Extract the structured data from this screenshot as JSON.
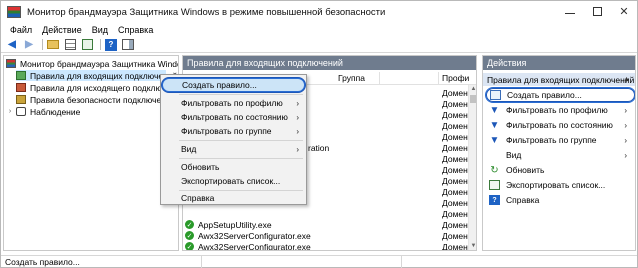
{
  "window": {
    "title": "Монитор брандмауэра Защитника Windows в режиме повышенной безопасности"
  },
  "menubar": [
    "Файл",
    "Действие",
    "Вид",
    "Справка"
  ],
  "tree": {
    "items": [
      {
        "label": "Монитор брандмауэра Защитника Windows в",
        "icon": "firewall-icon"
      },
      {
        "label": "Правила для входящих подключений",
        "icon": "inbound-rules-icon",
        "selected": true
      },
      {
        "label": "Правила для исходящего подключения",
        "icon": "outbound-rules-icon"
      },
      {
        "label": "Правила безопасности подключения",
        "icon": "connection-security-icon"
      },
      {
        "label": "Наблюдение",
        "icon": "monitoring-icon"
      }
    ]
  },
  "middle": {
    "header": "Правила для входящих подключений",
    "columns": {
      "group": "Группа",
      "profile": "Профи"
    },
    "rows": [
      {
        "name": "",
        "profile": "Домен"
      },
      {
        "name": "",
        "profile": "Домен"
      },
      {
        "name": "",
        "profile": "Домен"
      },
      {
        "name": "",
        "profile": "Домен"
      },
      {
        "name": "",
        "profile": "Домен"
      },
      {
        "name": "ration",
        "profile": "Домен"
      },
      {
        "name": "",
        "profile": "Домен"
      },
      {
        "name": "",
        "profile": "Домен"
      },
      {
        "name": "",
        "profile": "Домен"
      },
      {
        "name": "",
        "profile": "Домен"
      },
      {
        "name": "",
        "profile": "Домен"
      },
      {
        "name": "",
        "profile": "Домен"
      },
      {
        "name": "AppSetupUtility.exe",
        "profile": "Домен"
      },
      {
        "name": "Awx32ServerConfigurator.exe",
        "profile": "Домен"
      },
      {
        "name": "Awx32ServerConfigurator.exe",
        "profile": "Домен"
      }
    ]
  },
  "context_menu": {
    "items": [
      {
        "label": "Создать правило...",
        "highlighted": true
      },
      {
        "label": "Фильтровать по профилю",
        "submenu": true
      },
      {
        "label": "Фильтровать по состоянию",
        "submenu": true
      },
      {
        "label": "Фильтровать по группе",
        "submenu": true
      },
      {
        "label": "Вид",
        "submenu": true
      },
      {
        "label": "Обновить"
      },
      {
        "label": "Экспортировать список..."
      },
      {
        "label": "Справка"
      }
    ]
  },
  "actions": {
    "title": "Действия",
    "section": "Правила для входящих подключений",
    "items": [
      {
        "label": "Создать правило...",
        "icon": "new-rule-icon",
        "highlighted": true
      },
      {
        "label": "Фильтровать по профилю",
        "icon": "filter-icon"
      },
      {
        "label": "Фильтровать по состоянию",
        "icon": "filter-icon"
      },
      {
        "label": "Фильтровать по группе",
        "icon": "filter-icon"
      },
      {
        "label": "Вид",
        "icon": "",
        "submenu": true
      },
      {
        "label": "Обновить",
        "icon": "refresh-icon"
      },
      {
        "label": "Экспортировать список...",
        "icon": "export-icon"
      },
      {
        "label": "Справка",
        "icon": "help-icon"
      }
    ]
  },
  "statusbar": {
    "text": "Создать правило..."
  }
}
